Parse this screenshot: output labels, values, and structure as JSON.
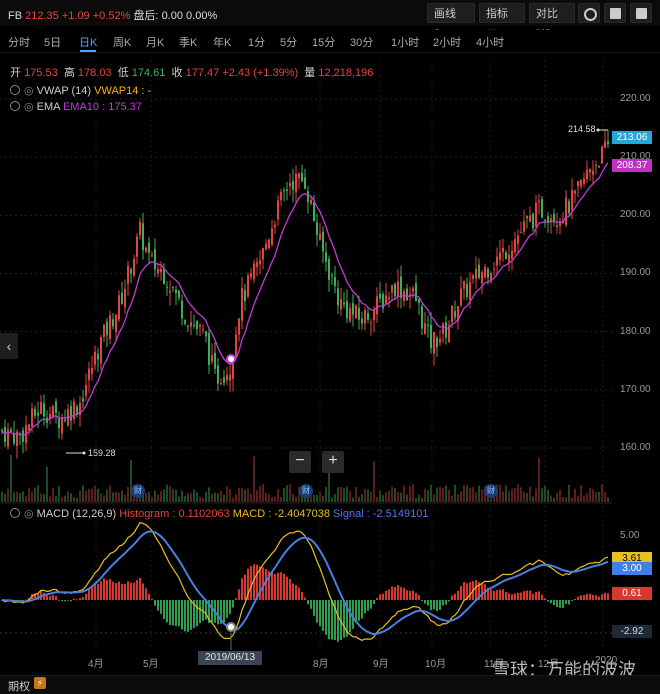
{
  "header": {
    "symbol": "FB",
    "price": "212.35",
    "change": "+1.09",
    "change_pct": "+0.52%",
    "after_hours_label": "盘后:",
    "after_hours_value": "0.00",
    "after_hours_pct": "0.00%",
    "draw_label": "画线",
    "indicator_label": "指标",
    "compare_label": "对比",
    "compare_vs": "VS"
  },
  "periods": [
    "分时",
    "5日",
    "日K",
    "周K",
    "月K",
    "季K",
    "年K",
    "1分",
    "5分",
    "15分",
    "30分",
    "1小时",
    "2小时",
    "4小时"
  ],
  "active_period": "日K",
  "ohlc": {
    "open_label": "开",
    "open": "175.53",
    "high_label": "高",
    "high": "178.03",
    "low_label": "低",
    "low": "174.61",
    "close_label": "收",
    "close": "177.47",
    "change": "+2.43 (+1.39%)",
    "volume_label": "量",
    "volume": "12,218,196"
  },
  "indicators": {
    "vwap_name": "VWAP (14)",
    "vwap_value": "VWAP14 : -",
    "ema_name": "EMA",
    "ema_value": "EMA10 : 175.37"
  },
  "macd": {
    "name": "MACD (12,26,9)",
    "histogram": "Histogram : 0.1102063",
    "macd": "MACD : -2.4047038",
    "signal": "Signal : -2.5149101"
  },
  "y_axis": [
    "220.00",
    "210.00",
    "200.00",
    "190.00",
    "180.00",
    "170.00",
    "160.00"
  ],
  "macd_axis": [
    "5.00",
    "-2.92"
  ],
  "price_tags": {
    "current": "213.06",
    "ema": "208.37",
    "high_marker": "214.58",
    "low_marker": "159.28",
    "macd_signal": "3.61",
    "macd_line": "3.00",
    "macd_hist": "0.61"
  },
  "x_axis": [
    "4月",
    "5月",
    "8月",
    "9月",
    "10月",
    "11月",
    "12月",
    "2020"
  ],
  "crosshair_date": "2019/06/13",
  "earnings_label": "财",
  "zoom": {
    "minus": "−",
    "plus": "+"
  },
  "bottom": {
    "options_label": "期权"
  },
  "watermark": "雪球：万能的波波",
  "colors": {
    "up": "#e0463f",
    "down": "#3fae5a",
    "vwap": "#ffb300",
    "ema": "#c23bd6",
    "macd": "#4a7fe0",
    "signal": "#e8c020",
    "active": "#4aa3ff"
  }
}
